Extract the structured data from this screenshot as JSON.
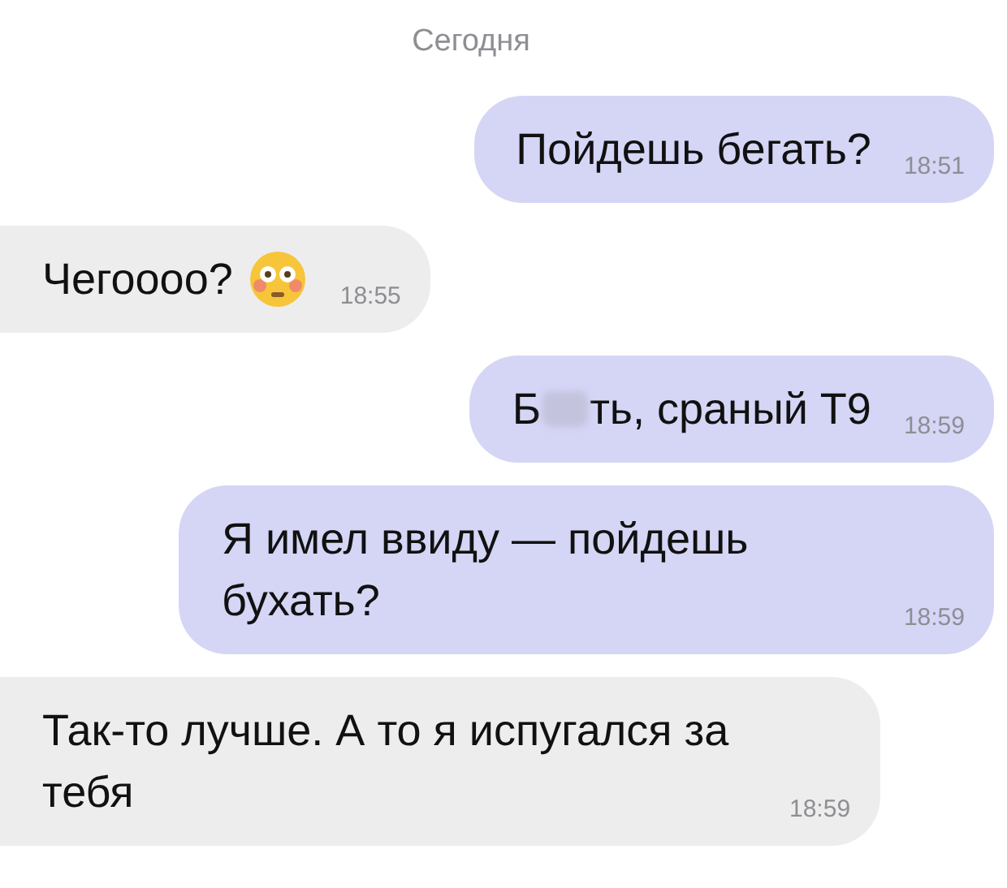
{
  "date_header": "Сегодня",
  "messages": [
    {
      "kind": "text",
      "outgoing": true,
      "text": "Пойдешь бегать?",
      "time": "18:51"
    },
    {
      "kind": "emoji",
      "outgoing": false,
      "text": "Чегоооо?",
      "time": "18:55"
    },
    {
      "kind": "censored",
      "outgoing": true,
      "text_before": "Б",
      "text_after": "ть, сраный Т9",
      "time": "18:59"
    },
    {
      "kind": "text",
      "outgoing": true,
      "text": "Я имел ввиду — пойдешь бухать?",
      "time": "18:59"
    },
    {
      "kind": "text",
      "outgoing": false,
      "text": "Так-то лучше. А то я испугался за тебя",
      "time": "18:59"
    }
  ]
}
